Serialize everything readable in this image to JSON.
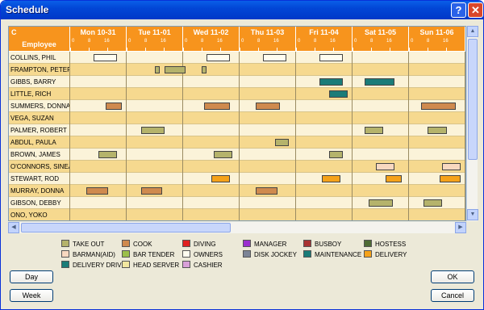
{
  "window": {
    "title": "Schedule",
    "help_label": "?",
    "close_label": "✕"
  },
  "header": {
    "corner_label": "C",
    "employee_label": "Employee",
    "days": [
      "Mon 10-31",
      "Tue 11-01",
      "Wed 11-02",
      "Thu 11-03",
      "Fri 11-04",
      "Sat 11-05",
      "Sun 11-06"
    ],
    "tick_labels": [
      "0",
      "8",
      "16"
    ]
  },
  "colors": {
    "take_out": "#b5b36b",
    "cook": "#cf8a4e",
    "diving": "#e02020",
    "manager": "#9b2fcf",
    "busboy": "#a83232",
    "hostess": "#4e6b35",
    "barman": "#f8d8c0",
    "bar_tender": "#9bbf4a",
    "disk_jockey": "#7c8496",
    "maintenance": "#1a7c78",
    "delivery": "#f5a21a",
    "delivery_driver": "#1a7c78",
    "head_server": "#f2e7a0",
    "owners": "#fffdf0",
    "cashier": "#d9a0d9"
  },
  "employees": [
    {
      "name": "COLLINS, PHIL",
      "shifts": [
        {
          "day": 0,
          "start": 10,
          "end": 20,
          "role": "owners"
        },
        {
          "day": 2,
          "start": 10,
          "end": 20,
          "role": "owners"
        },
        {
          "day": 3,
          "start": 10,
          "end": 20,
          "role": "owners"
        },
        {
          "day": 4,
          "start": 10,
          "end": 20,
          "role": "owners"
        }
      ]
    },
    {
      "name": "FRAMPTON, PETER",
      "shifts": [
        {
          "day": 1,
          "start": 12,
          "end": 14,
          "role": "take_out"
        },
        {
          "day": 1,
          "start": 16,
          "end": 25,
          "role": "take_out"
        },
        {
          "day": 2,
          "start": 8,
          "end": 10,
          "role": "take_out"
        }
      ]
    },
    {
      "name": "GIBBS, BARRY",
      "shifts": [
        {
          "day": 4,
          "start": 10,
          "end": 20,
          "role": "maintenance"
        },
        {
          "day": 5,
          "start": 5,
          "end": 18,
          "role": "maintenance"
        }
      ]
    },
    {
      "name": "LITTLE, RICH",
      "shifts": [
        {
          "day": 4,
          "start": 14,
          "end": 22,
          "role": "maintenance"
        }
      ]
    },
    {
      "name": "SUMMERS, DONNA",
      "shifts": [
        {
          "day": 0,
          "start": 15,
          "end": 22,
          "role": "cook"
        },
        {
          "day": 2,
          "start": 9,
          "end": 20,
          "role": "cook"
        },
        {
          "day": 3,
          "start": 7,
          "end": 17,
          "role": "cook"
        },
        {
          "day": 6,
          "start": 5,
          "end": 20,
          "role": "cook"
        }
      ]
    },
    {
      "name": "VEGA, SUZAN",
      "shifts": []
    },
    {
      "name": "PALMER, ROBERT",
      "shifts": [
        {
          "day": 1,
          "start": 6,
          "end": 16,
          "role": "take_out"
        },
        {
          "day": 5,
          "start": 5,
          "end": 13,
          "role": "take_out"
        },
        {
          "day": 6,
          "start": 8,
          "end": 16,
          "role": "take_out"
        }
      ]
    },
    {
      "name": "ABDUL, PAULA",
      "shifts": [
        {
          "day": 3,
          "start": 15,
          "end": 21,
          "role": "take_out"
        }
      ]
    },
    {
      "name": "BROWN, JAMES",
      "shifts": [
        {
          "day": 0,
          "start": 12,
          "end": 20,
          "role": "take_out"
        },
        {
          "day": 2,
          "start": 13,
          "end": 21,
          "role": "take_out"
        },
        {
          "day": 4,
          "start": 14,
          "end": 20,
          "role": "take_out"
        }
      ]
    },
    {
      "name": "O'CONNORS, SINEAD",
      "shifts": [
        {
          "day": 5,
          "start": 10,
          "end": 18,
          "role": "barman"
        },
        {
          "day": 6,
          "start": 14,
          "end": 22,
          "role": "barman"
        }
      ]
    },
    {
      "name": "STEWART, ROD",
      "shifts": [
        {
          "day": 2,
          "start": 12,
          "end": 20,
          "role": "delivery"
        },
        {
          "day": 4,
          "start": 11,
          "end": 19,
          "role": "delivery"
        },
        {
          "day": 5,
          "start": 14,
          "end": 21,
          "role": "delivery"
        },
        {
          "day": 6,
          "start": 13,
          "end": 22,
          "role": "delivery"
        }
      ]
    },
    {
      "name": "MURRAY, DONNA",
      "shifts": [
        {
          "day": 0,
          "start": 7,
          "end": 16,
          "role": "cook"
        },
        {
          "day": 1,
          "start": 6,
          "end": 15,
          "role": "cook"
        },
        {
          "day": 3,
          "start": 7,
          "end": 16,
          "role": "cook"
        }
      ]
    },
    {
      "name": "GIBSON, DEBBY",
      "shifts": [
        {
          "day": 5,
          "start": 7,
          "end": 17,
          "role": "take_out"
        },
        {
          "day": 6,
          "start": 6,
          "end": 14,
          "role": "take_out"
        }
      ]
    },
    {
      "name": "ONO, YOKO",
      "shifts": []
    }
  ],
  "legend": [
    {
      "key": "take_out",
      "label": "TAKE OUT"
    },
    {
      "key": "cook",
      "label": "COOK"
    },
    {
      "key": "diving",
      "label": "DIVING"
    },
    {
      "key": "manager",
      "label": "MANAGER"
    },
    {
      "key": "busboy",
      "label": "BUSBOY"
    },
    {
      "key": "hostess",
      "label": "HOSTESS"
    },
    {
      "key": "barman",
      "label": "BARMAN(AID)"
    },
    {
      "key": "bar_tender",
      "label": "BAR TENDER"
    },
    {
      "key": "owners",
      "label": "OWNERS"
    },
    {
      "key": "disk_jockey",
      "label": "DISK JOCKEY"
    },
    {
      "key": "maintenance",
      "label": "MAINTENANCE"
    },
    {
      "key": "delivery",
      "label": "DELIVERY"
    },
    {
      "key": "delivery_driver",
      "label": "DELIVERY DRIVI"
    },
    {
      "key": "head_server",
      "label": "HEAD SERVER"
    },
    {
      "key": "cashier",
      "label": "CASHIER"
    }
  ],
  "buttons": {
    "day": "Day",
    "week": "Week",
    "ok": "OK",
    "cancel": "Cancel"
  }
}
